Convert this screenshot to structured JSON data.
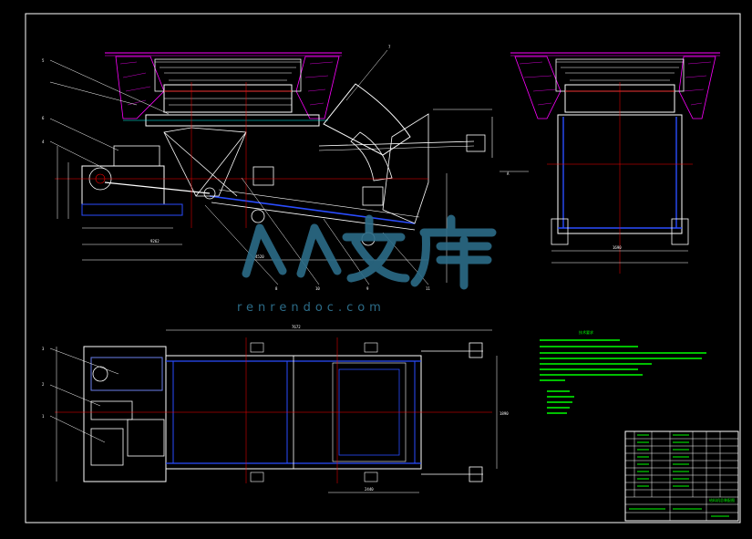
{
  "drawing": {
    "background": "#000000",
    "colors": {
      "outline": "#ffffff",
      "blue": "#2a4dff",
      "red": "#ff0000",
      "magenta": "#ff00ff",
      "green": "#00ff00",
      "cyan": "#00c8ff",
      "yellow": "#ffff00"
    },
    "leader_labels": {
      "side_view": [
        "5",
        "6",
        "4",
        "7"
      ],
      "side_view_bottom": [
        "8",
        "10",
        "9",
        "11"
      ],
      "plan_view": [
        "3",
        "2",
        "1"
      ],
      "section_mark": "A"
    },
    "dimensions": {
      "plan_overall": "7672",
      "plan_right": "1890",
      "plan_bottom": "2440",
      "side_bottom_a": "9262",
      "side_bottom_b": "4520",
      "section_width": "1690"
    }
  },
  "watermark": {
    "logo_text": "人人文库",
    "url_text": "renrendoc.com"
  },
  "notes": {
    "title": "技术要求"
  },
  "title_block": {
    "drawing_title": "给料机总装配图"
  }
}
